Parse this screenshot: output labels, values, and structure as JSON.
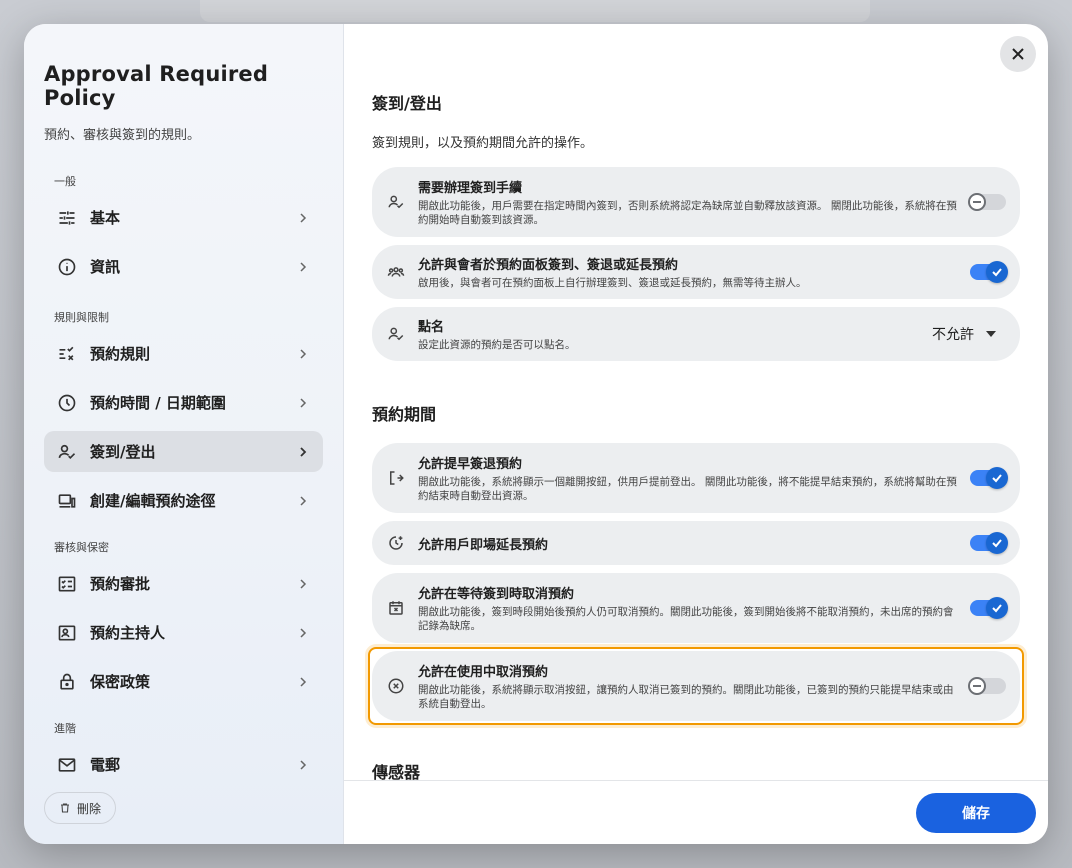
{
  "colors": {
    "accent": "#1a62e0",
    "highlight": "#f29900",
    "toggle_on": "#3b82f6"
  },
  "sidebar": {
    "title": "Approval Required Policy",
    "subtitle": "預約、審核與簽到的規則。",
    "sections": [
      {
        "label": "一般",
        "items": [
          {
            "label": "基本",
            "icon": "tune-icon"
          },
          {
            "label": "資訊",
            "icon": "info-icon"
          }
        ]
      },
      {
        "label": "規則與限制",
        "items": [
          {
            "label": "預約規則",
            "icon": "rule-icon"
          },
          {
            "label": "預約時間 / 日期範圍",
            "icon": "clock-icon"
          },
          {
            "label": "簽到/登出",
            "icon": "person-check-icon",
            "active": true
          },
          {
            "label": "創建/編輯預約途徑",
            "icon": "devices-icon"
          }
        ]
      },
      {
        "label": "審核與保密",
        "items": [
          {
            "label": "預約審批",
            "icon": "checklist-icon"
          },
          {
            "label": "預約主持人",
            "icon": "host-icon"
          },
          {
            "label": "保密政策",
            "icon": "lock-icon"
          }
        ]
      },
      {
        "label": "進階",
        "items": [
          {
            "label": "電郵",
            "icon": "mail-icon"
          }
        ]
      }
    ],
    "delete_label": "刪除"
  },
  "main": {
    "section1": {
      "title": "簽到/登出",
      "description": "簽到規則，以及預約期間允許的操作。",
      "cards": [
        {
          "title": "需要辦理簽到手續",
          "desc": "開啟此功能後，用戶需要在指定時間內簽到，否則系統將認定為缺席並自動釋放該資源。 關閉此功能後，系統將在預約開始時自動簽到該資源。",
          "toggle": "off"
        },
        {
          "title": "允許與會者於預約面板簽到、簽退或延長預約",
          "desc": "啟用後，與會者可在預約面板上自行辦理簽到、簽退或延長預約，無需等待主辦人。",
          "toggle": "on"
        },
        {
          "title": "點名",
          "desc": "設定此資源的預約是否可以點名。",
          "dropdown_value": "不允許"
        }
      ]
    },
    "section2": {
      "title": "預約期間",
      "cards": [
        {
          "title": "允許提早簽退預約",
          "desc": "開啟此功能後，系統將顯示一個離開按鈕，供用戶提前登出。 關閉此功能後，將不能提早結束預約，系統將幫助在預約結束時自動登出資源。",
          "toggle": "on"
        },
        {
          "title": "允許用戶即場延長預約",
          "desc": "",
          "toggle": "on"
        },
        {
          "title": "允許在等待簽到時取消預約",
          "desc": "開啟此功能後，簽到時段開始後預約人仍可取消預約。關閉此功能後，簽到開始後將不能取消預約，未出席的預約會記錄為缺席。",
          "toggle": "on"
        },
        {
          "title": "允許在使用中取消預約",
          "desc": "開啟此功能後，系統將顯示取消按鈕，讓預約人取消已簽到的預約。關閉此功能後，已簽到的預約只能提早結束或由系統自動登出。",
          "toggle": "off"
        }
      ]
    },
    "section3": {
      "title": "傳感器"
    },
    "save_label": "儲存"
  }
}
